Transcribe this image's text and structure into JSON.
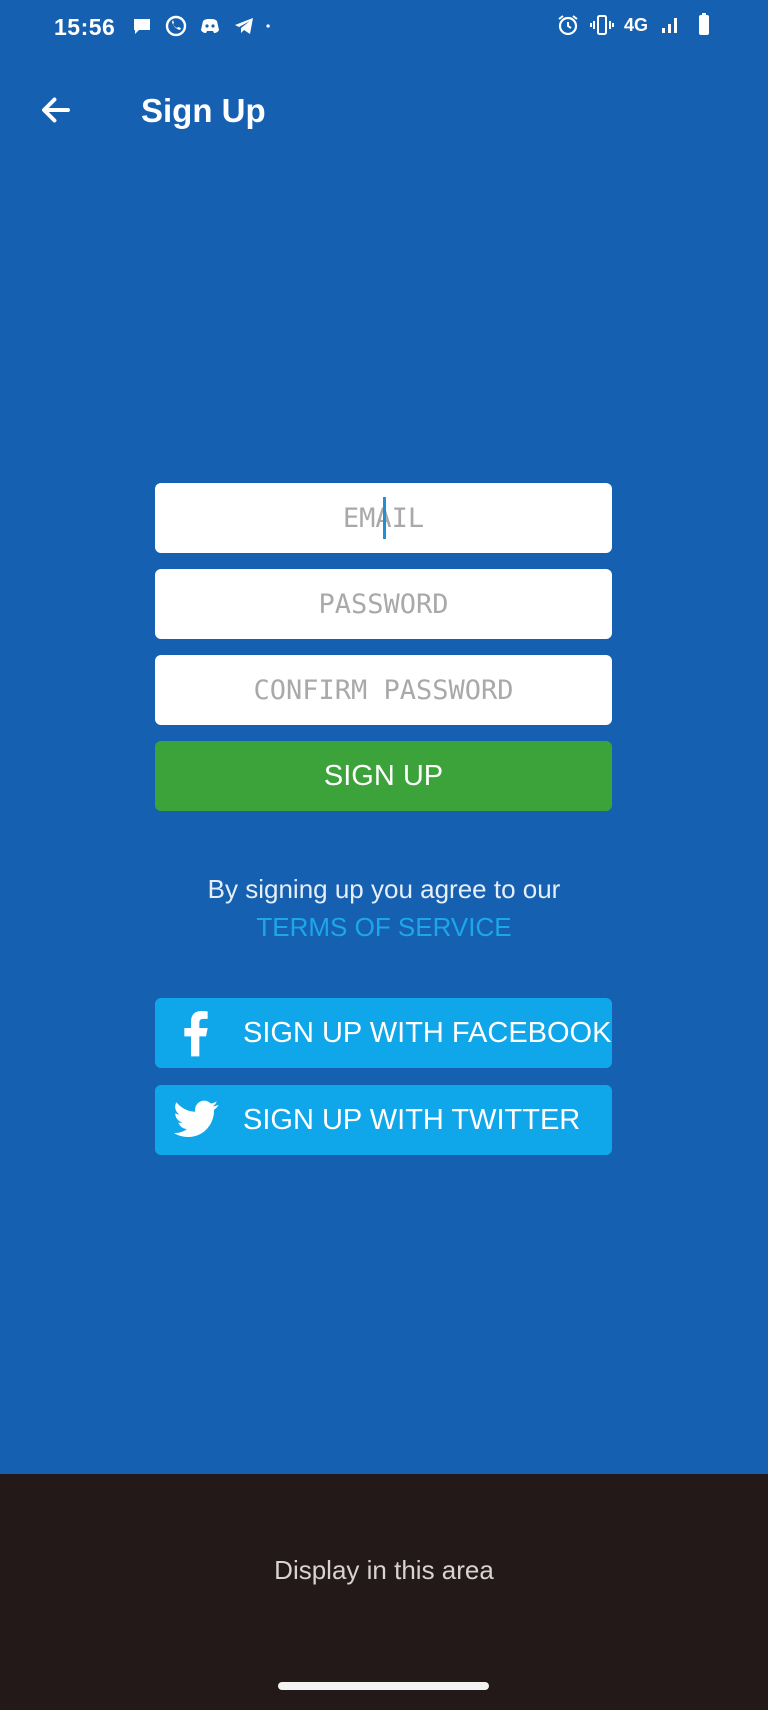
{
  "status_bar": {
    "time": "15:56",
    "network": "4G",
    "left_icons": [
      "chat-bubble-icon",
      "whatsapp-icon",
      "discord-icon",
      "telegram-icon",
      "dot-icon"
    ],
    "right_icons": [
      "alarm-icon",
      "vibrate-icon",
      "signal-icon",
      "battery-icon"
    ]
  },
  "appbar": {
    "title": "Sign Up",
    "back_icon": "arrow-left-icon"
  },
  "form": {
    "email_placeholder": "EMAIL",
    "password_placeholder": "PASSWORD",
    "confirm_password_placeholder": "CONFIRM PASSWORD",
    "signup_label": "SIGN UP"
  },
  "terms": {
    "text": "By signing up you agree to our",
    "link": "TERMS OF SERVICE"
  },
  "social": {
    "facebook_label": "SIGN UP WITH FACEBOOK",
    "twitter_label": "SIGN UP WITH TWITTER"
  },
  "bottom": {
    "text": "Display in this area"
  },
  "colors": {
    "background": "#1560b0",
    "signup_button": "#3ba33a",
    "social_button": "#10a6ea",
    "link": "#1ea6ea",
    "bottom_area": "#231918"
  }
}
